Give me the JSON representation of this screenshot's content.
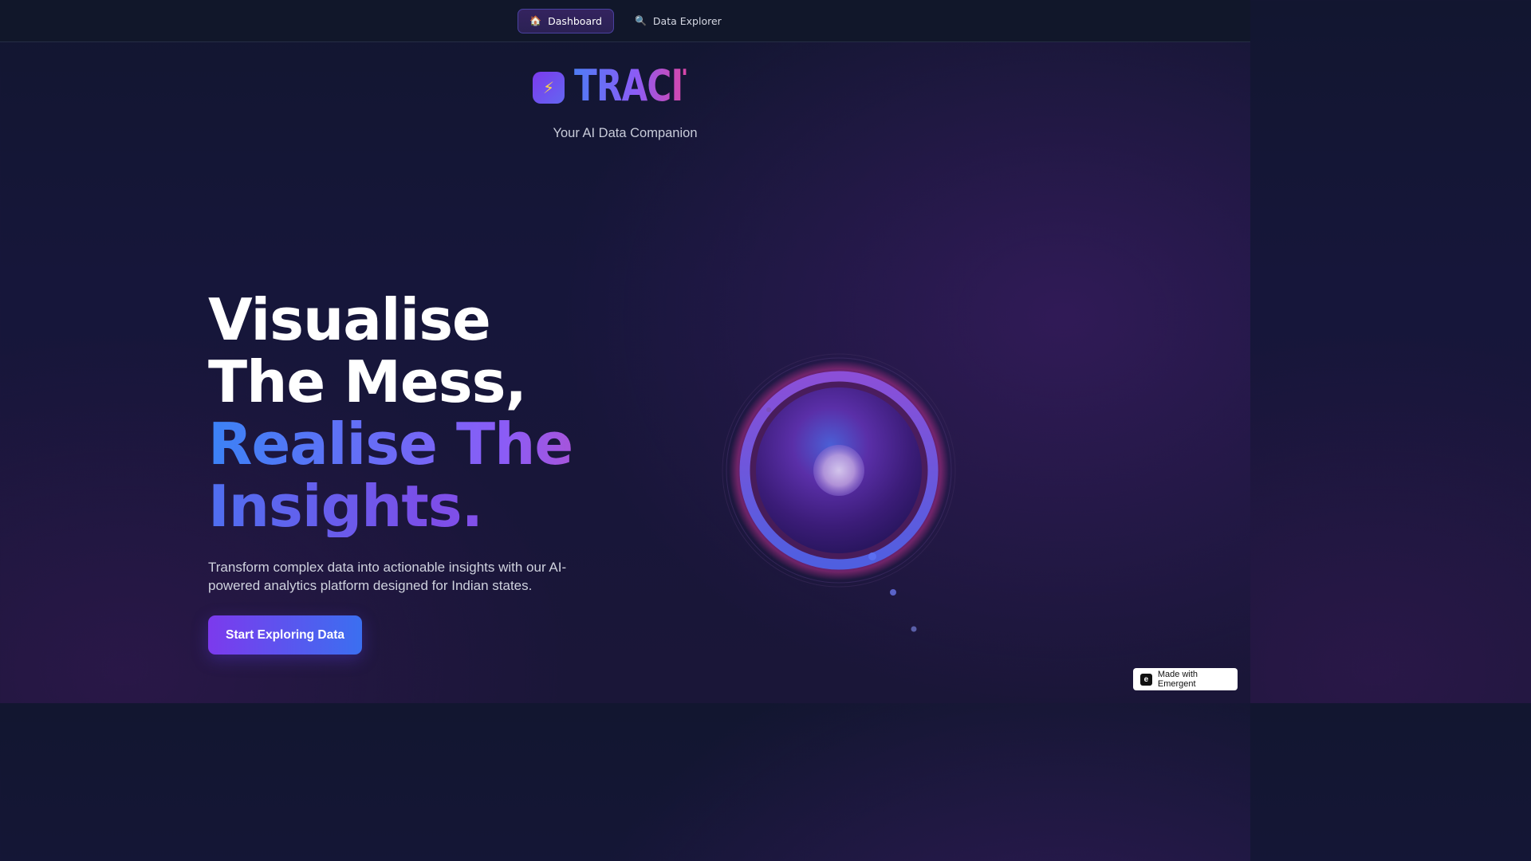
{
  "nav": {
    "items": [
      {
        "label": "Dashboard",
        "icon": "🏠",
        "icon_name": "home-icon",
        "active": true
      },
      {
        "label": "Data Explorer",
        "icon": "🔍",
        "icon_name": "search-icon",
        "active": false
      }
    ]
  },
  "brand": {
    "name": "TRACITY",
    "badge_icon": "⚡",
    "badge_icon_name": "lightning-icon",
    "tagline": "Your AI Data Companion"
  },
  "hero": {
    "line1": "Visualise",
    "line2": "The Mess,",
    "line3": "Realise The",
    "line4": "Insights.",
    "description": "Transform complex data into actionable insights with our AI-powered analytics platform designed for Indian states.",
    "cta_label": "Start Exploring Data"
  },
  "badge": {
    "label": "Made with Emergent",
    "logo_glyph": "e"
  },
  "colors": {
    "accent_purple": "#7c3aed",
    "accent_blue": "#3b82f6",
    "accent_pink": "#d946a8",
    "background": "#16163a"
  }
}
